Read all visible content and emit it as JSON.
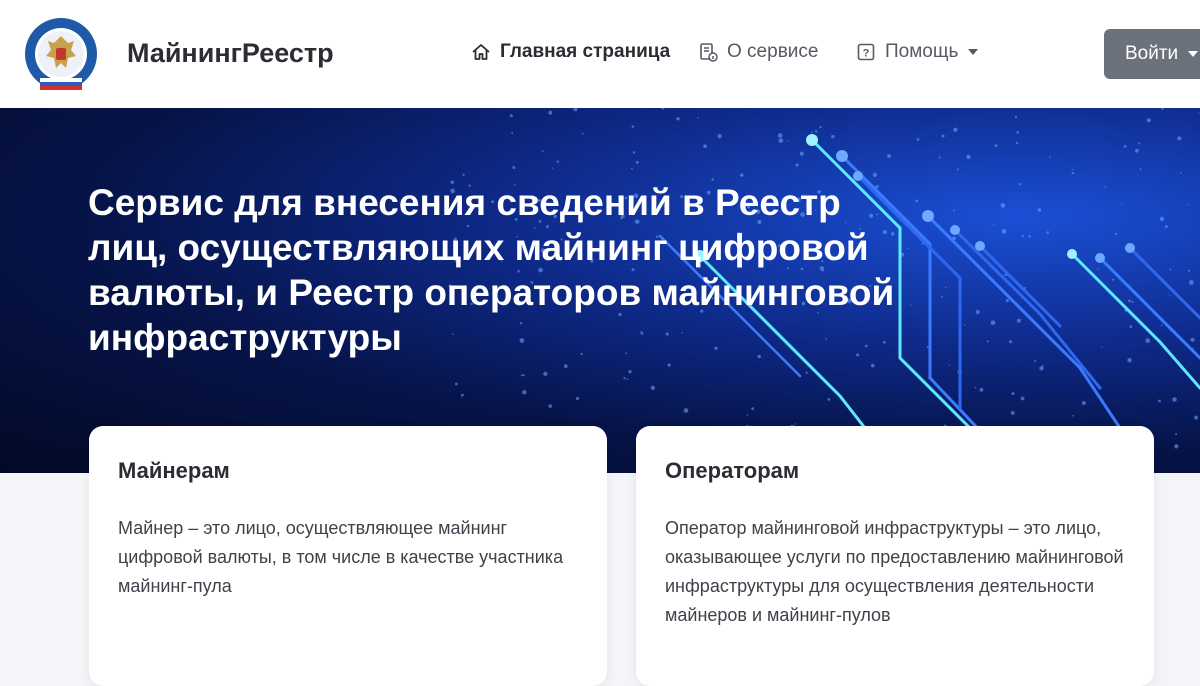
{
  "header": {
    "brand": "МайнингРеестр",
    "nav": {
      "home": "Главная страница",
      "about": "О сервисе",
      "help": "Помощь"
    },
    "login": "Войти"
  },
  "hero": {
    "title": "Сервис для внесения сведений в Реестр лиц, осуществляющих майнинг цифровой валюты, и Реестр операторов майнинговой инфраструктуры"
  },
  "cards": {
    "miners": {
      "title": "Майнерам",
      "text": "Майнер – это лицо, осуществляющее майнинг цифровой валюты, в том числе в качестве участника майнинг-пула"
    },
    "operators": {
      "title": "Операторам",
      "text": "Оператор майнинговой инфраструктуры – это лицо, оказывающее услуги по предоставлению майнинговой инфраструктуры для осуществления деятельности майнеров и майнинг-пулов"
    }
  },
  "icons": {
    "logo": "fns-emblem-icon",
    "home": "home-icon",
    "about": "document-info-icon",
    "help": "question-icon"
  },
  "colors": {
    "accent": "#6c727b",
    "hero_dark": "#030a26",
    "hero_bright": "#1b4fd6",
    "circuit": "#5ee8ff"
  }
}
